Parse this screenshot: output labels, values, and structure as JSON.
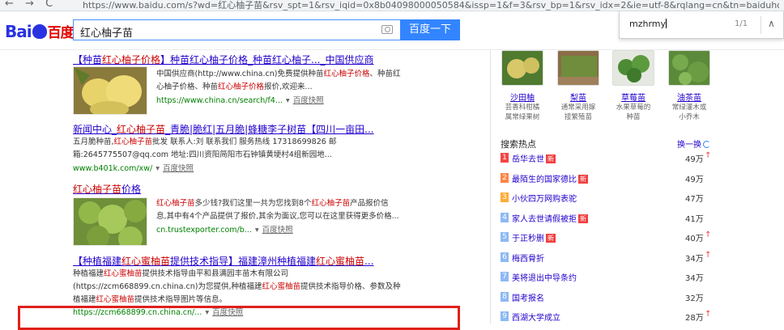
{
  "browser": {
    "url": "https://www.baidu.com/s?wd=红心柚子苗&rsv_spt=1&rsv_iqid=0x8b04098000050584&issp=1&f=3&rsv_bp=1&rsv_idx=2&ie=utf-8&rqlang=cn&tn=baiduhome_pg&rsv",
    "back": "←",
    "forward": "→",
    "reload": "C"
  },
  "search": {
    "query": "红心柚子苗",
    "button": "百度一下"
  },
  "findbar": {
    "query": "mzhrmy",
    "count": "1/1",
    "up": "∧"
  },
  "results": [
    {
      "title_pre": "【种苗",
      "title_em": "红心柚子价格",
      "title_post": "】种苗红心柚子价格_种苗红心柚子..._中国供应商",
      "text_lines": [
        "中国供应商(http://www.china.cn)免费提供种苗红心柚子价格、种苗红",
        "心柚子价格、种苗红心柚子价格报价,欢迎来..."
      ],
      "url": "https://www.china.cn/search/f4...",
      "snapshot": "百度快照"
    },
    {
      "title": "新闻中心_红心柚子苗_青脆|脆红|五月脆|蜂糖李子树苗【四川一亩田...",
      "text_lines": [
        "五月脆种苗,红心柚子苗批发 联系人:刘 联系我们 服务热线 17318699826 邮",
        "箱:2645775507@qq.com 地址:四川资阳简阳市石钟镇黄埂村4组新园地..."
      ],
      "url": "www.b401k.com/xw/",
      "snapshot": "百度快照"
    },
    {
      "title": "红心柚子苗价格",
      "text_lines": [
        "红心柚子苗多少钱?我们这里一共为您找到8个红心柚子苗产品报价信",
        "息,其中有4个产品提供了报价,其余为面议,您可以在这里获得更多价格..."
      ],
      "url": "cn.trustexporter.com/b...",
      "snapshot": "百度快照"
    },
    {
      "title": "【种植福建红心蜜柚苗提供技术指导】福建漳州种植福建红心蜜柚苗...",
      "text_lines": [
        "种植福建红心蜜柚苗提供技术指导由平和县满园丰苗木有限公司",
        "(https://zcm668899.cn.china.cn)为您提供,种植福建红心蜜柚苗提供技术指导价格、参数及种",
        "植福建红心蜜柚苗提供技术指导图片等信息。"
      ],
      "url": "https://zcm668899.cn.china.cn/...",
      "snapshot": "百度快照"
    }
  ],
  "sidebar": {
    "trees": [
      {
        "name": "沙田柚",
        "desc": [
          "芸香科柑橘",
          "属常绿果树"
        ]
      },
      {
        "name": "梨苗",
        "desc": [
          "通常采用嫁",
          "接繁殖苗"
        ]
      },
      {
        "name": "草莓苗",
        "desc": [
          "水果草莓的",
          "种苗"
        ]
      },
      {
        "name": "油茶苗",
        "desc": [
          "常绿灌木或",
          "小乔木"
        ]
      }
    ],
    "hot_title": "搜索热点",
    "refresh": "换一换",
    "hot": [
      {
        "rank": "1",
        "text": "岳华去世",
        "badge": "新",
        "value": "49万",
        "up": true
      },
      {
        "rank": "2",
        "text": "最陌生的国家德比",
        "badge": "新",
        "value": "49万",
        "up": false
      },
      {
        "rank": "3",
        "text": "小伙四万网购表驼",
        "badge": "",
        "value": "47万",
        "up": false
      },
      {
        "rank": "4",
        "text": "家人去世请假被拒",
        "badge": "新",
        "value": "41万",
        "up": false
      },
      {
        "rank": "5",
        "text": "于正秒删",
        "badge": "新",
        "value": "40万",
        "up": true
      },
      {
        "rank": "6",
        "text": "梅西骨折",
        "badge": "",
        "value": "34万",
        "up": true
      },
      {
        "rank": "7",
        "text": "美将退出中导条约",
        "badge": "",
        "value": "34万",
        "up": false
      },
      {
        "rank": "8",
        "text": "国考报名",
        "badge": "",
        "value": "32万",
        "up": false
      },
      {
        "rank": "9",
        "text": "西湖大学成立",
        "badge": "",
        "value": "28万",
        "up": true
      }
    ],
    "rank_colors": [
      "#f54545",
      "#ff8547",
      "#ffac38",
      "#8eb9f5",
      "#8eb9f5",
      "#8eb9f5",
      "#8eb9f5",
      "#8eb9f5",
      "#8eb9f5"
    ]
  }
}
